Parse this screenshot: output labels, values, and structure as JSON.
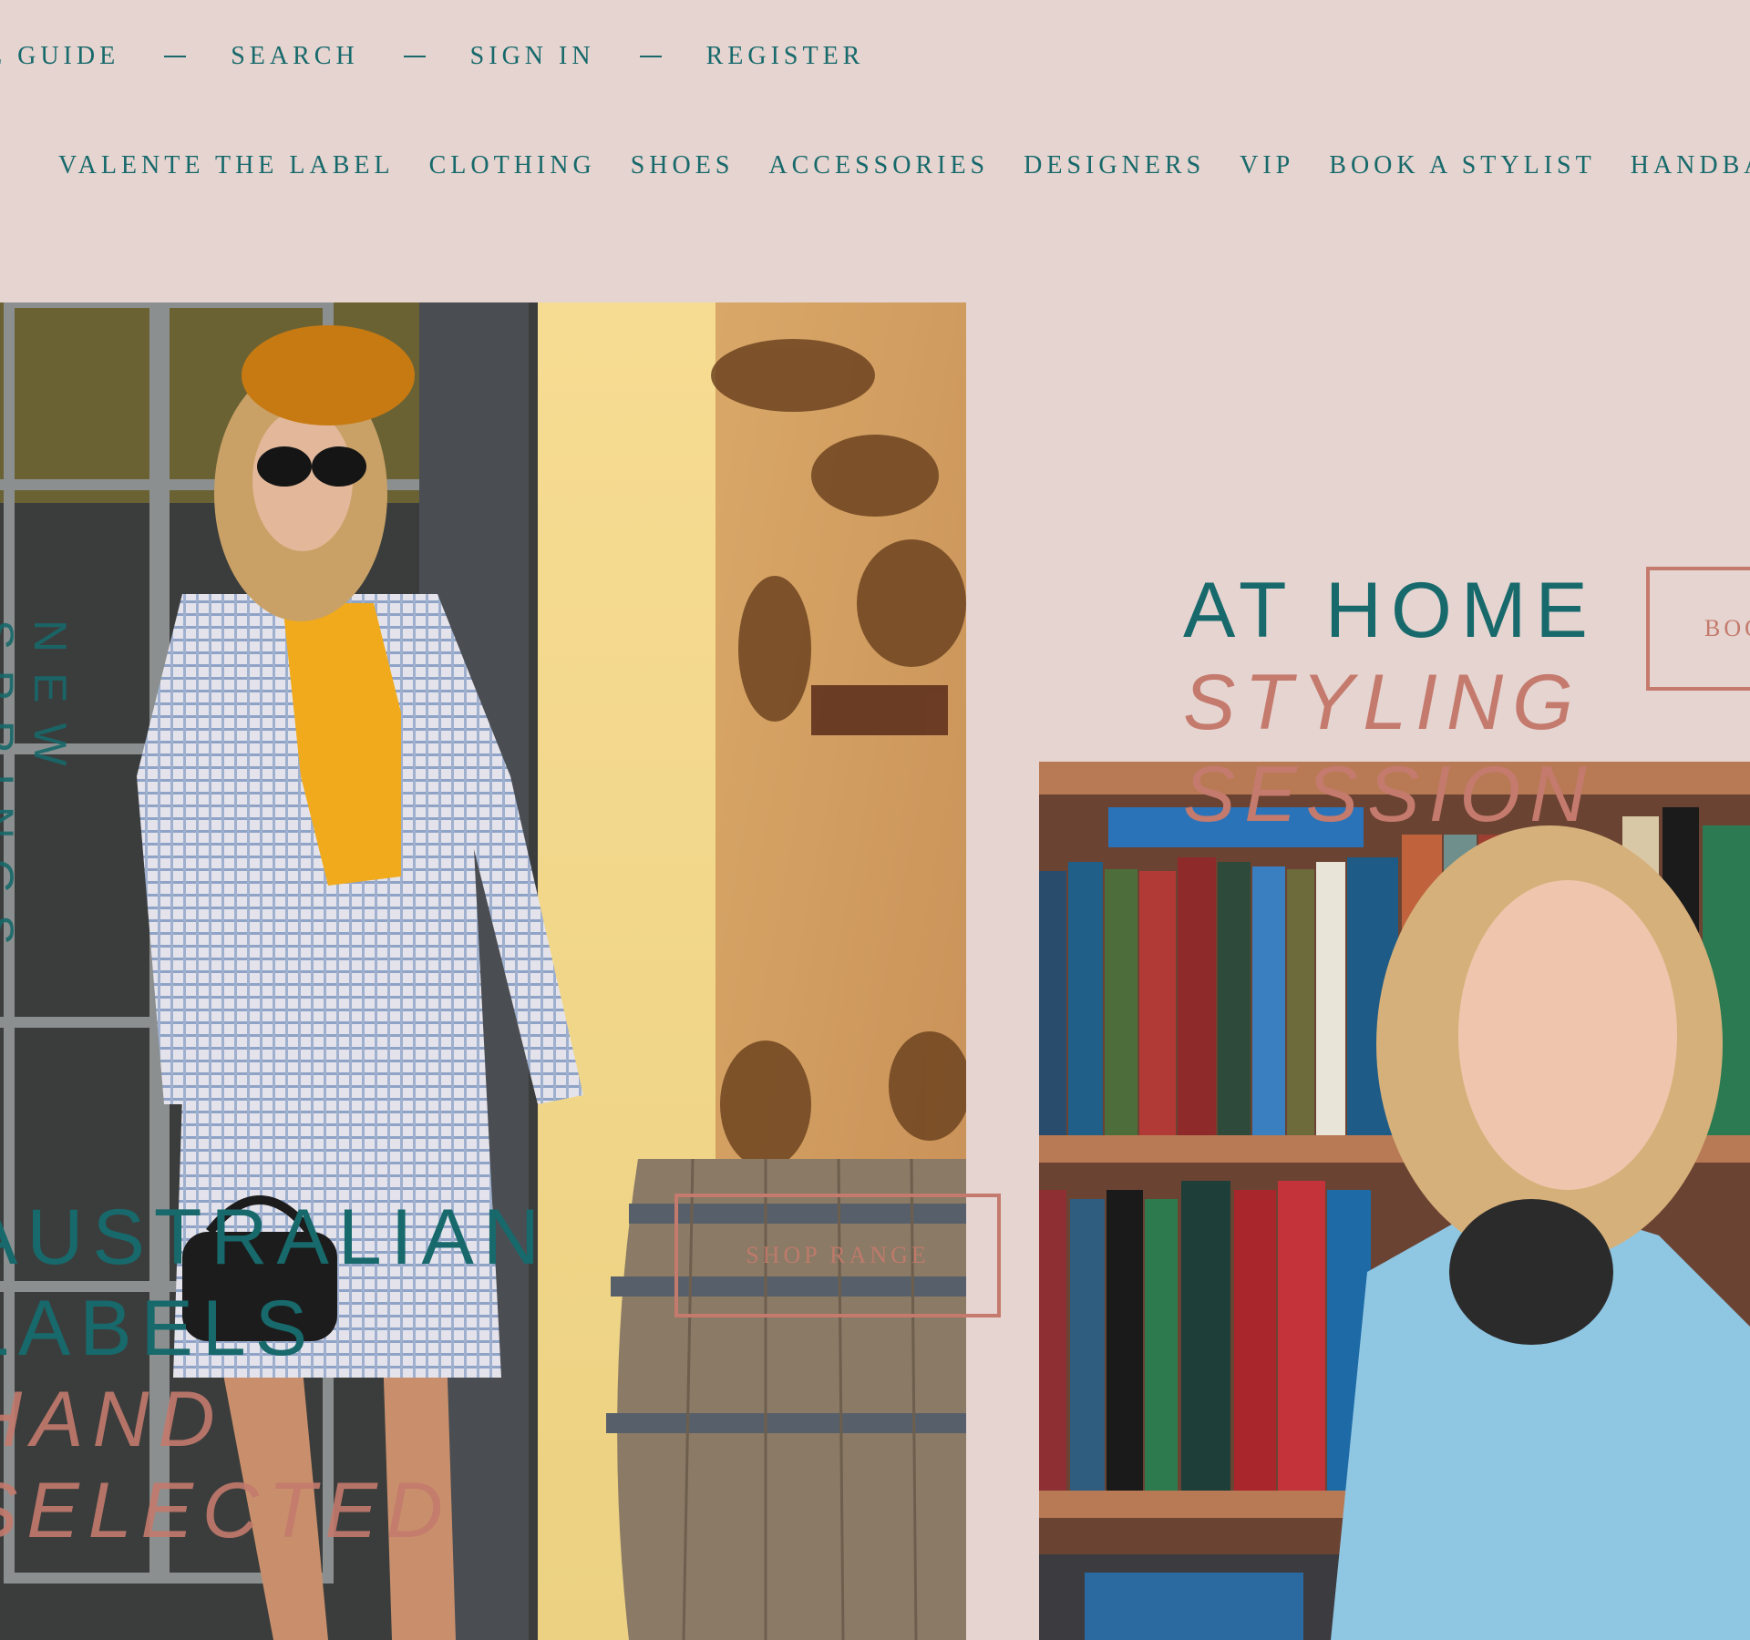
{
  "top_links": [
    "SIZE GUIDE",
    "SEARCH",
    "SIGN IN",
    "REGISTER"
  ],
  "main_nav": [
    "VALENTE THE LABEL",
    "CLOTHING",
    "SHOES",
    "ACCESSORIES",
    "DESIGNERS",
    "VIP",
    "BOOK A STYLIST",
    "HANDBAGS"
  ],
  "vertical_text": "NEW SPRINGS",
  "hero_left": {
    "line1": "AUSTRALIAN",
    "line2": "LABELS",
    "line3": "HAND",
    "line4": "SELECTED",
    "button": "SHOP RANGE"
  },
  "hero_right": {
    "line1": "AT HOME",
    "line2": "STYLING",
    "line3": "SESSION",
    "button": "BOOK"
  },
  "colors": {
    "background": "#e5d4d0",
    "teal": "#17696b",
    "rose": "#c47a6d"
  }
}
